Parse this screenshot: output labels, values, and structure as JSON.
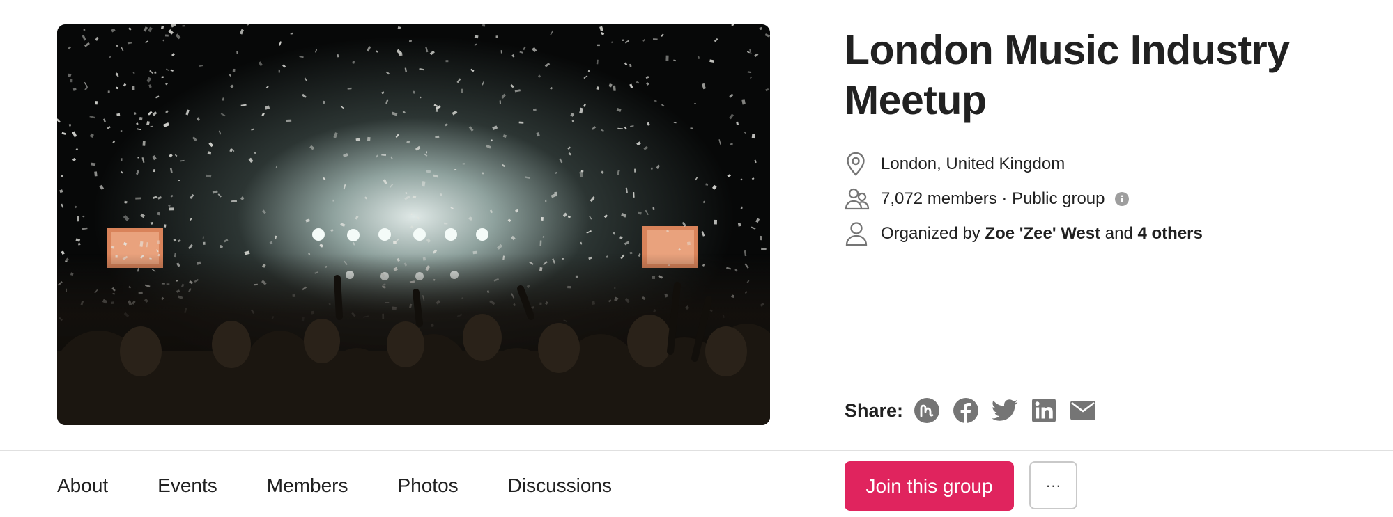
{
  "group": {
    "title": "London Music Industry Meetup",
    "location": "London, United Kingdom",
    "members_text": "7,072 members · Public group",
    "organized_prefix": "Organized by ",
    "organizer": "Zoe 'Zee' West",
    "organized_mid": " and ",
    "others": "4 others"
  },
  "share": {
    "label": "Share:",
    "icons": [
      "meetup-icon",
      "facebook-icon",
      "twitter-icon",
      "linkedin-icon",
      "email-icon"
    ]
  },
  "nav": {
    "tabs": [
      {
        "label": "About"
      },
      {
        "label": "Events"
      },
      {
        "label": "Members"
      },
      {
        "label": "Photos"
      },
      {
        "label": "Discussions"
      }
    ]
  },
  "actions": {
    "join_label": "Join this group",
    "more_label": "···"
  },
  "colors": {
    "accent": "#e0245e",
    "icon_gray": "#757575",
    "text": "#212121"
  }
}
